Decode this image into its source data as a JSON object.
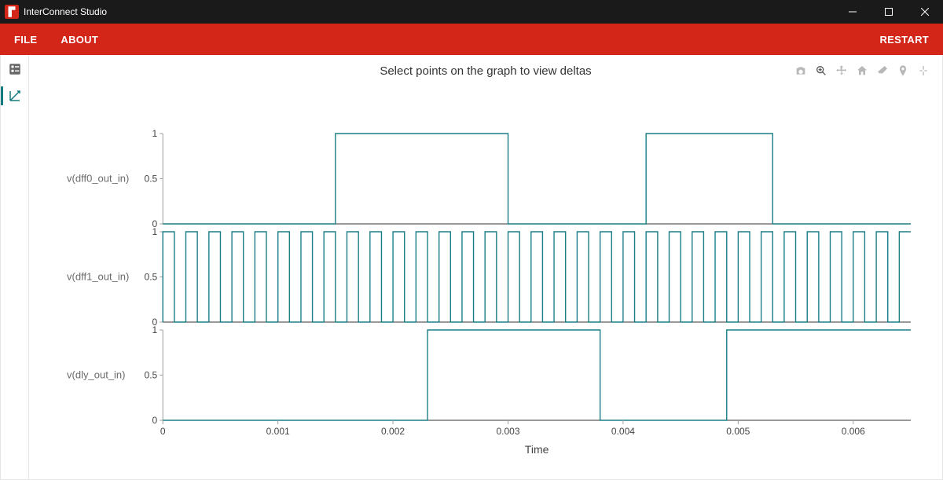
{
  "titlebar": {
    "app_name": "InterConnect Studio"
  },
  "menubar": {
    "file": "FILE",
    "about": "ABOUT",
    "restart": "RESTART"
  },
  "main": {
    "caption": "Select points on the graph to view deltas",
    "xaxis_title": "Time"
  },
  "modebar": {
    "items": [
      "camera",
      "zoom",
      "pan",
      "home",
      "eraser",
      "spike",
      "autoscale"
    ],
    "active": "zoom"
  },
  "chart_data": [
    {
      "type": "line",
      "name": "v(dff0_out_in)",
      "x_range": [
        0,
        0.0065
      ],
      "ylim": [
        0,
        1
      ],
      "yticks": [
        0,
        0.5,
        1
      ],
      "transitions": [
        [
          0.0,
          0
        ],
        [
          0.0015,
          0
        ],
        [
          0.0015,
          1
        ],
        [
          0.003,
          1
        ],
        [
          0.003,
          0
        ],
        [
          0.0042,
          0
        ],
        [
          0.0042,
          1
        ],
        [
          0.0053,
          1
        ],
        [
          0.0053,
          0
        ],
        [
          0.0065,
          0
        ]
      ]
    },
    {
      "type": "line",
      "name": "v(dff1_out_in)",
      "x_range": [
        0,
        0.0065
      ],
      "ylim": [
        0,
        1
      ],
      "yticks": [
        0,
        0.5,
        1
      ],
      "period": 0.0002,
      "duty": 0.5,
      "note": "square wave, ~32 cycles across the window"
    },
    {
      "type": "line",
      "name": "v(dly_out_in)",
      "x_range": [
        0,
        0.0065
      ],
      "ylim": [
        0,
        1
      ],
      "yticks": [
        0,
        0.5,
        1
      ],
      "transitions": [
        [
          0.0,
          0
        ],
        [
          0.0023,
          0
        ],
        [
          0.0023,
          1
        ],
        [
          0.0038,
          1
        ],
        [
          0.0038,
          0
        ],
        [
          0.0049,
          0
        ],
        [
          0.0049,
          1
        ],
        [
          0.0065,
          1
        ]
      ]
    }
  ],
  "xaxis": {
    "range": [
      0,
      0.0065
    ],
    "ticks": [
      0,
      0.001,
      0.002,
      0.003,
      0.004,
      0.005,
      0.006
    ],
    "tick_labels": [
      "0",
      "0.001",
      "0.002",
      "0.003",
      "0.004",
      "0.005",
      "0.006"
    ]
  }
}
